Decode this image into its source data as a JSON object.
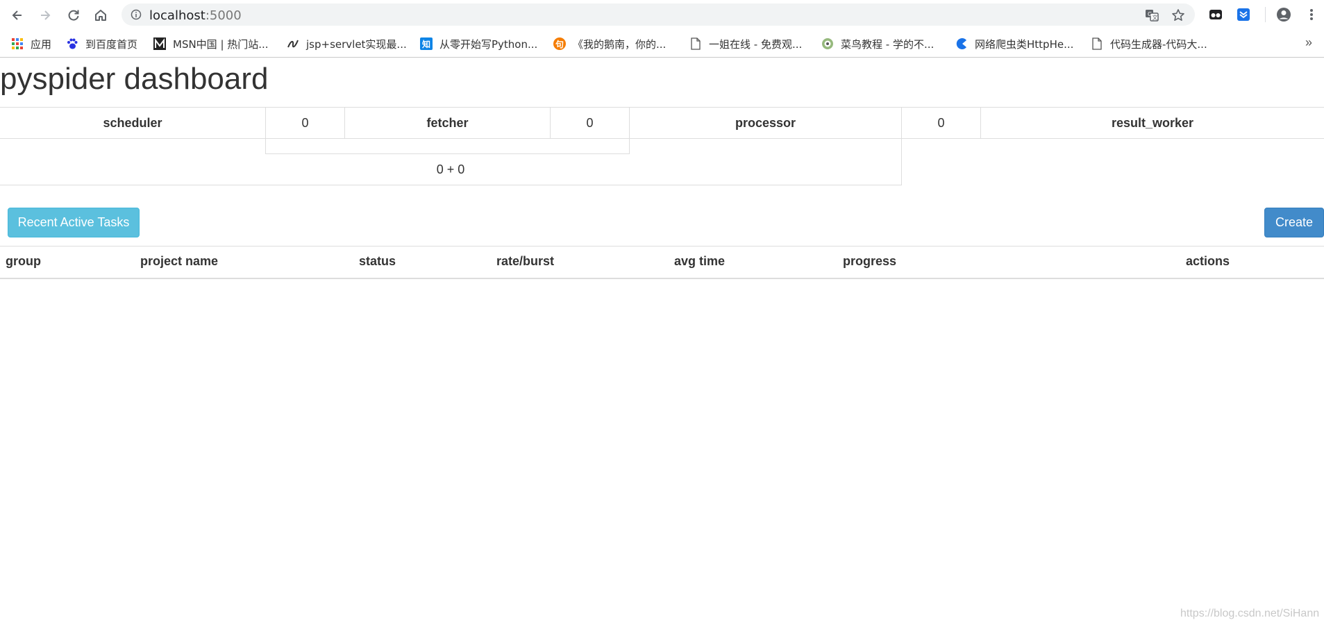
{
  "browser": {
    "url_host": "localhost",
    "url_port": ":5000",
    "bookmarks": [
      {
        "label": "应用",
        "icon": "apps-grid-icon"
      },
      {
        "label": "到百度首页",
        "icon": "baidu-paw-icon"
      },
      {
        "label": "MSN中国 | 热门站...",
        "icon": "msn-icon"
      },
      {
        "label": "jsp+servlet实现最...",
        "icon": "jsp-icon"
      },
      {
        "label": "从零开始写Python...",
        "icon": "zhihu-icon"
      },
      {
        "label": "《我的鹅南，你的...",
        "icon": "weibo-like-icon"
      },
      {
        "label": "一姐在线 - 免费观...",
        "icon": "page-icon"
      },
      {
        "label": "菜鸟教程 - 学的不...",
        "icon": "runoob-icon"
      },
      {
        "label": "网络爬虫类HttpHe...",
        "icon": "csdn-icon"
      },
      {
        "label": "代码生成器-代码大...",
        "icon": "page-icon"
      }
    ],
    "overflow_label": "»"
  },
  "page": {
    "title": "pyspider dashboard"
  },
  "components": {
    "scheduler": {
      "label": "scheduler",
      "value": "0"
    },
    "fetcher": {
      "label": "fetcher",
      "value": "0"
    },
    "processor": {
      "label": "processor",
      "value": "0"
    },
    "result_worker": {
      "label": "result_worker"
    },
    "queue_sum": "0 + 0"
  },
  "actions": {
    "recent_tasks_label": "Recent Active Tasks",
    "create_label": "Create"
  },
  "table": {
    "columns": [
      "group",
      "project name",
      "status",
      "rate/burst",
      "avg time",
      "progress",
      "actions"
    ]
  },
  "watermark": "https://blog.csdn.net/SiHann",
  "colors": {
    "info_button": "#5bc0de",
    "primary_button": "#428bca",
    "border": "#dddddd"
  }
}
